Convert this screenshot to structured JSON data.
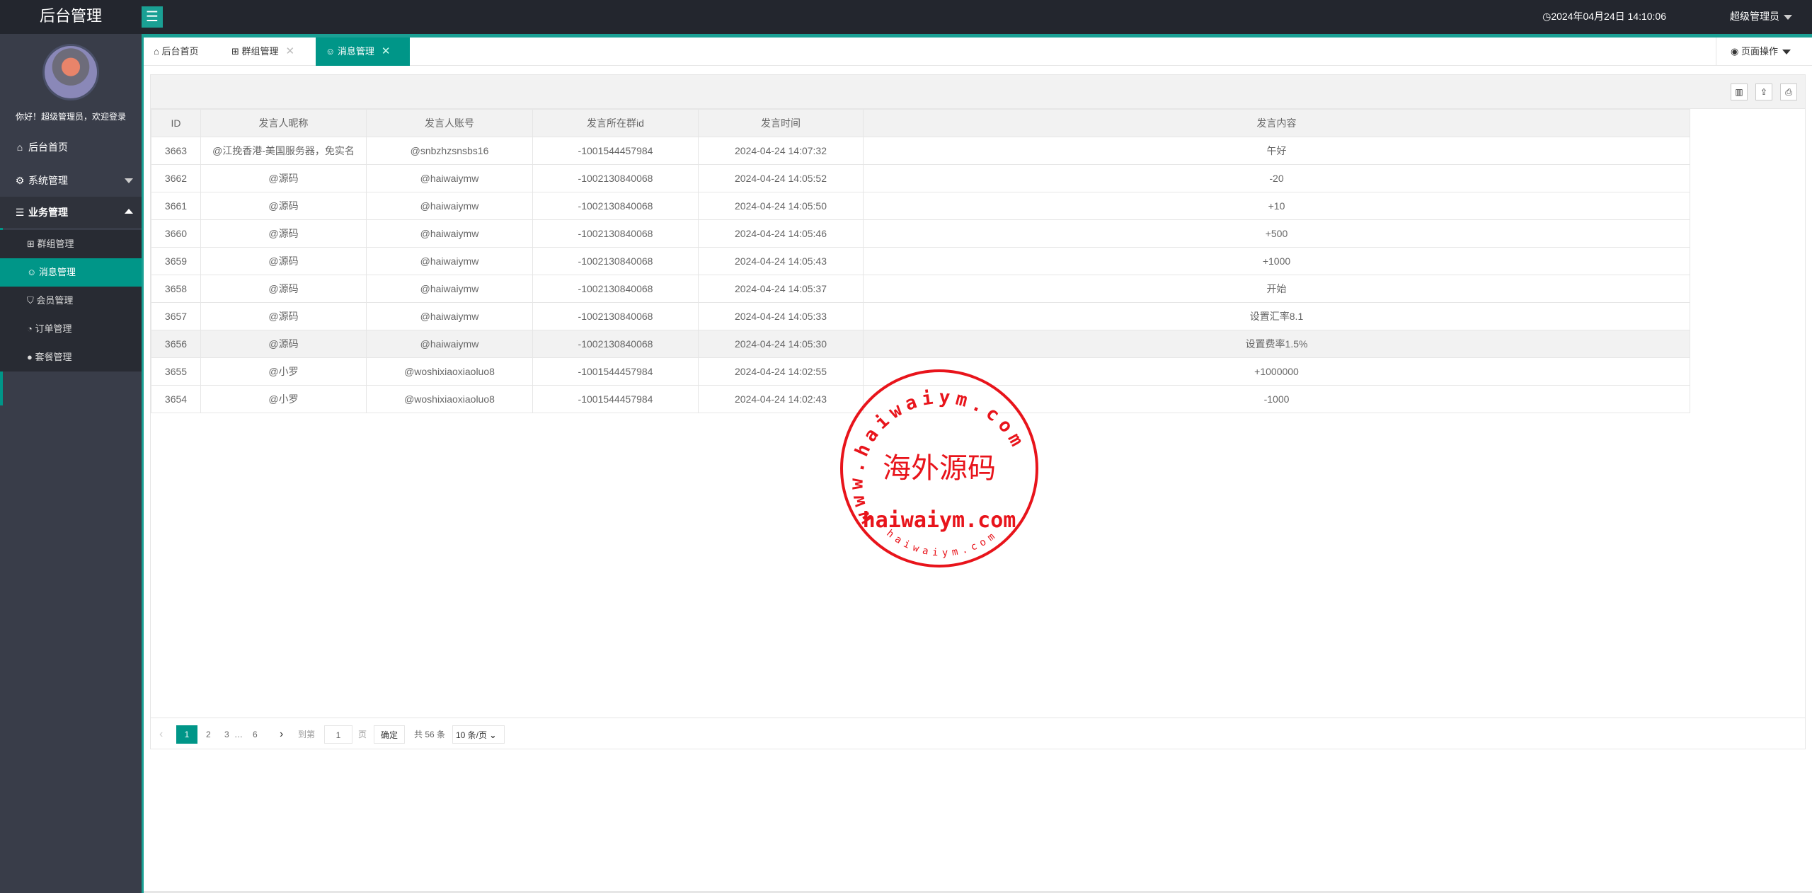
{
  "header": {
    "title": "后台管理",
    "menu_icon": "hamburger-icon",
    "clock": "2024年04月24日 14:10:06",
    "user": "超级管理员"
  },
  "sidebar": {
    "welcome": "你好！超级管理员，欢迎登录",
    "items": [
      {
        "label": "后台首页",
        "icon": "home-icon"
      },
      {
        "label": "系统管理",
        "icon": "gear-icon"
      },
      {
        "label": "业务管理",
        "icon": "layers-icon"
      }
    ],
    "sub": [
      {
        "label": "群组管理",
        "icon": "apps-icon"
      },
      {
        "label": "消息管理",
        "icon": "smile-icon",
        "active": true
      },
      {
        "label": "会员管理",
        "icon": "shield-icon"
      },
      {
        "label": "订单管理",
        "icon": "dashboard-icon"
      },
      {
        "label": "套餐管理",
        "icon": "compass-icon"
      }
    ]
  },
  "tabs": [
    {
      "label": "后台首页"
    },
    {
      "label": "群组管理"
    },
    {
      "label": "消息管理",
      "active": true
    }
  ],
  "page_ops": "页面操作",
  "table": {
    "headers": [
      "ID",
      "发言人昵称",
      "发言人账号",
      "发言所在群id",
      "发言时间",
      "发言内容"
    ],
    "rows": [
      [
        "3663",
        "@江挽香港-美国服务器，免实名",
        "@snbzhzsnsbs16",
        "-1001544457984",
        "2024-04-24 14:07:32",
        "午好"
      ],
      [
        "3662",
        "@源码",
        "@haiwaiymw",
        "-1002130840068",
        "2024-04-24 14:05:52",
        "-20"
      ],
      [
        "3661",
        "@源码",
        "@haiwaiymw",
        "-1002130840068",
        "2024-04-24 14:05:50",
        "+10"
      ],
      [
        "3660",
        "@源码",
        "@haiwaiymw",
        "-1002130840068",
        "2024-04-24 14:05:46",
        "+500"
      ],
      [
        "3659",
        "@源码",
        "@haiwaiymw",
        "-1002130840068",
        "2024-04-24 14:05:43",
        "+1000"
      ],
      [
        "3658",
        "@源码",
        "@haiwaiymw",
        "-1002130840068",
        "2024-04-24 14:05:37",
        "开始"
      ],
      [
        "3657",
        "@源码",
        "@haiwaiymw",
        "-1002130840068",
        "2024-04-24 14:05:33",
        "设置汇率8.1"
      ],
      [
        "3656",
        "@源码",
        "@haiwaiymw",
        "-1002130840068",
        "2024-04-24 14:05:30",
        "设置费率1.5%"
      ],
      [
        "3655",
        "@小罗",
        "@woshixiaoxiaoluo8",
        "-1001544457984",
        "2024-04-24 14:02:55",
        "+1000000"
      ],
      [
        "3654",
        "@小罗",
        "@woshixiaoxiaoluo8",
        "-1001544457984",
        "2024-04-24 14:02:43",
        "-1000"
      ]
    ]
  },
  "pager": {
    "pages": [
      "1",
      "2",
      "3",
      "…",
      "6"
    ],
    "goto": "到第",
    "page_value": "1",
    "page_unit": "页",
    "confirm": "确定",
    "total": "共 56 条",
    "per_page": "10 条/页"
  },
  "watermark": {
    "ring": "www.haiwaiym.com",
    "center": "海外源码",
    "domain": "haiwaiym.com",
    "bottom": "haiwaiym.com",
    "color": "#e8141b"
  }
}
